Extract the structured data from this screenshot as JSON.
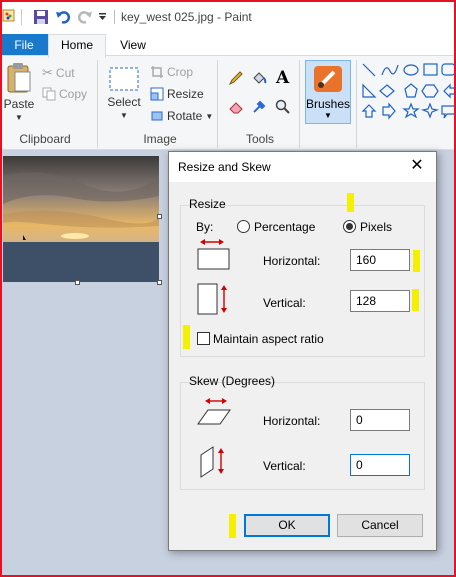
{
  "window": {
    "title": "key_west 025.jpg - Paint"
  },
  "tabs": {
    "file": "File",
    "home": "Home",
    "view": "View"
  },
  "ribbon": {
    "paste": "Paste",
    "cut": "Cut",
    "copy": "Copy",
    "clipboard_group": "Clipboard",
    "select": "Select",
    "crop": "Crop",
    "resize": "Resize",
    "rotate": "Rotate",
    "image_group": "Image",
    "tools_group": "Tools",
    "brushes": "Brushes"
  },
  "dialog": {
    "title": "Resize and Skew",
    "resize_group": "Resize",
    "by_label": "By:",
    "percentage": "Percentage",
    "pixels": "Pixels",
    "selected_unit": "Pixels",
    "resize_horizontal_label": "Horizontal:",
    "resize_horizontal_value": "160",
    "resize_vertical_label": "Vertical:",
    "resize_vertical_value": "128",
    "maintain_aspect": "Maintain aspect ratio",
    "maintain_aspect_checked": false,
    "skew_group": "Skew (Degrees)",
    "skew_horizontal_label": "Horizontal:",
    "skew_horizontal_value": "0",
    "skew_vertical_label": "Vertical:",
    "skew_vertical_value": "0",
    "ok": "OK",
    "cancel": "Cancel"
  },
  "colors": {
    "accent": "#1979ca",
    "highlight": "#f5ef00",
    "frame": "#e81123",
    "arrow": "#d40000"
  }
}
